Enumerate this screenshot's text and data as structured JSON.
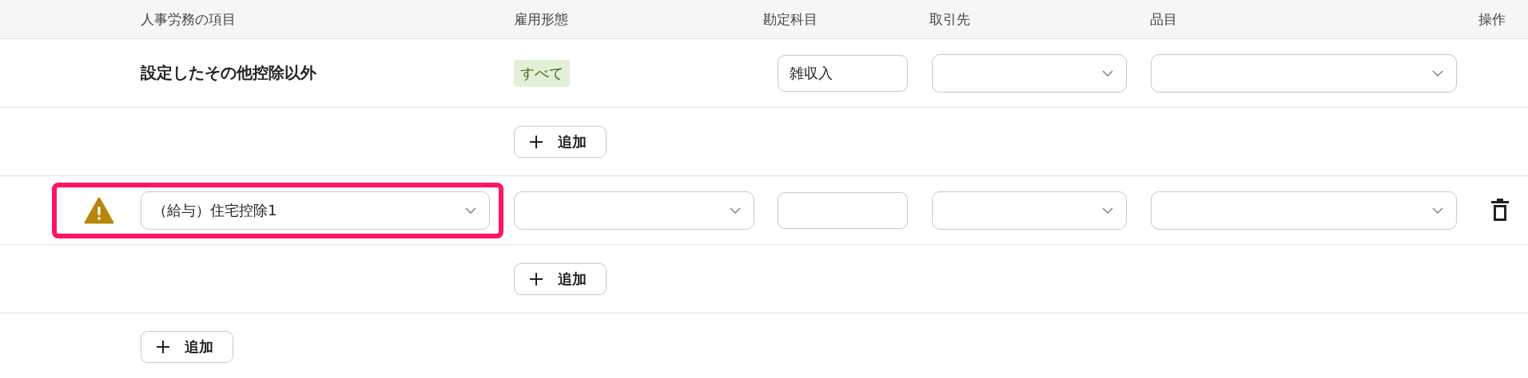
{
  "header": {
    "columns": [
      "人事労務の項目",
      "雇用形態",
      "勘定科目",
      "取引先",
      "品目",
      "操作"
    ]
  },
  "rows": [
    {
      "kind": "fixed",
      "item": "設定したその他控除以外",
      "employment_tag": "すべて",
      "account": "雑収入",
      "add_button": "追加"
    },
    {
      "kind": "custom",
      "item_select": "（給与）住宅控除1",
      "warning": true,
      "highlighted": true,
      "add_button": "追加"
    }
  ],
  "add_button": "追加"
}
